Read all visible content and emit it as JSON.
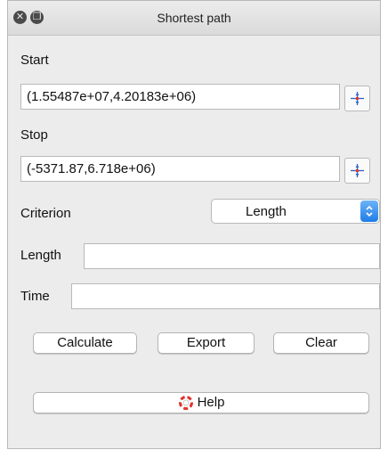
{
  "window": {
    "title": "Shortest path"
  },
  "start": {
    "label": "Start",
    "value": "(1.55487e+07,4.20183e+06)"
  },
  "stop": {
    "label": "Stop",
    "value": "(-5371.87,6.718e+06)"
  },
  "criterion": {
    "label": "Criterion",
    "selected": "Length"
  },
  "length": {
    "label": "Length",
    "value": ""
  },
  "time": {
    "label": "Time",
    "value": ""
  },
  "buttons": {
    "calculate": "Calculate",
    "export": "Export",
    "clear": "Clear",
    "help": "Help"
  },
  "icons": {
    "close": "close-icon",
    "float": "float-icon",
    "capture_point": "capture-point-icon",
    "combo_arrow": "chevron-updown-icon",
    "help": "help-icon"
  },
  "colors": {
    "accent": "#1f7de6",
    "capture_red": "#e0332e",
    "capture_blue": "#2a62c9"
  }
}
